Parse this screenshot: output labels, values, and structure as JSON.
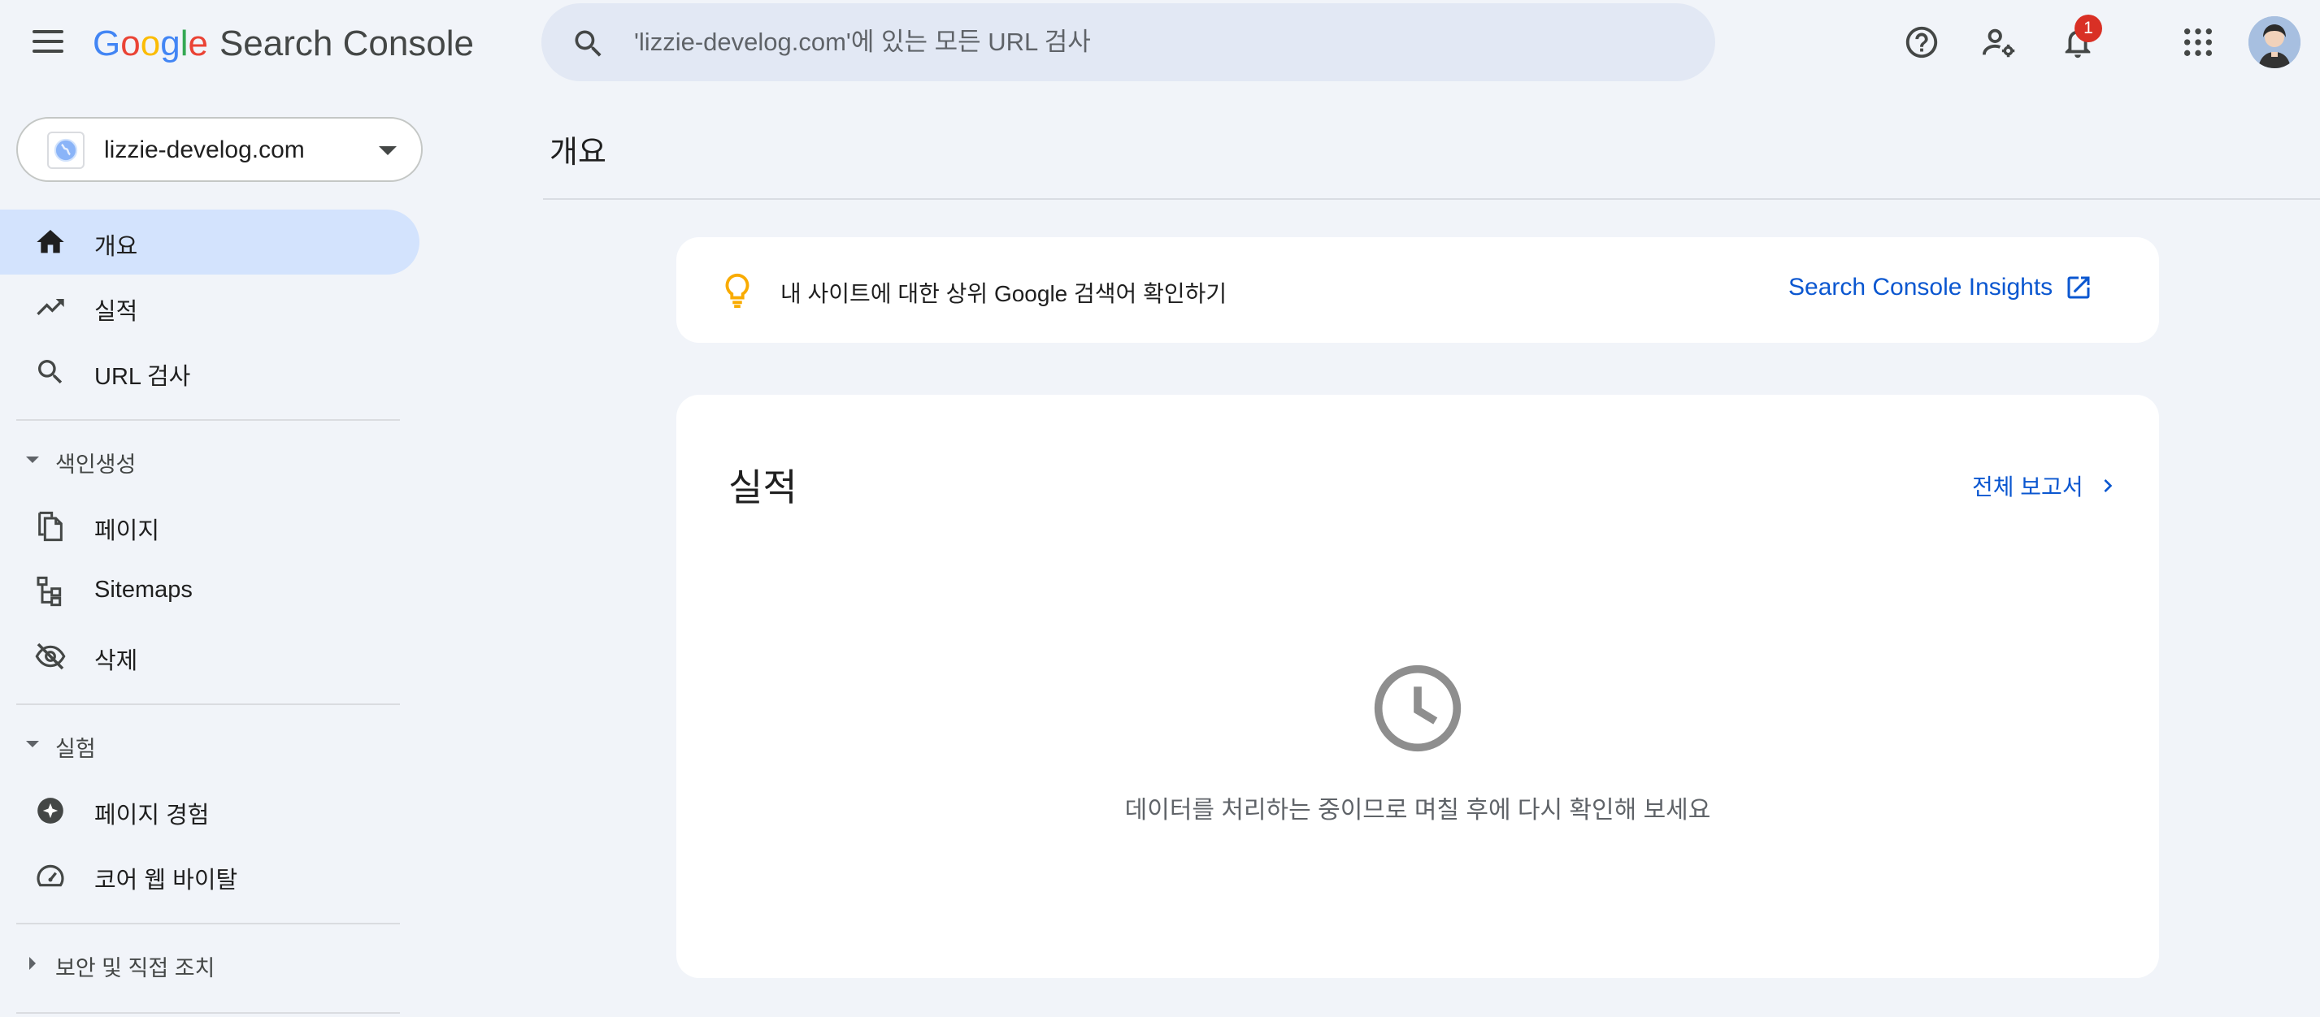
{
  "header": {
    "logo_letters": [
      "G",
      "o",
      "o",
      "g",
      "l",
      "e"
    ],
    "product_name": "Search Console",
    "search_placeholder": "'lizzie-develog.com'에 있는 모든 URL 검사",
    "notification_count": "1",
    "icons": [
      "menu-icon",
      "search-icon",
      "help-icon",
      "manage-users-icon",
      "bell-icon",
      "apps-grid-icon",
      "avatar"
    ]
  },
  "sidebar": {
    "property": "lizzie-develog.com",
    "items": [
      {
        "label": "개요",
        "icon": "home-icon",
        "active": true
      },
      {
        "label": "실적",
        "icon": "trending-up-icon"
      },
      {
        "label": "URL 검사",
        "icon": "search-icon"
      }
    ],
    "sections": [
      {
        "label": "색인생성",
        "expanded": true,
        "items": [
          {
            "label": "페이지",
            "icon": "pages-icon"
          },
          {
            "label": "Sitemaps",
            "icon": "sitemap-icon"
          },
          {
            "label": "삭제",
            "icon": "visibility-off-icon"
          }
        ]
      },
      {
        "label": "실험",
        "expanded": true,
        "items": [
          {
            "label": "페이지 경험",
            "icon": "experience-icon"
          },
          {
            "label": "코어 웹 바이탈",
            "icon": "speed-gauge-icon"
          }
        ]
      },
      {
        "label": "보안 및 직접 조치",
        "expanded": false
      }
    ]
  },
  "main": {
    "page_title": "개요",
    "insight": {
      "text": "내 사이트에 대한 상위 Google 검색어 확인하기",
      "link": "Search Console Insights"
    },
    "performance": {
      "title": "실적",
      "full_report": "전체 보고서",
      "message": "데이터를 처리하는 중이므로 며칠 후에 다시 확인해 보세요"
    }
  },
  "colors": {
    "background": "#f1f4f9",
    "active_nav": "#d3e3fd",
    "link": "#0b57d0",
    "badge": "#d93025"
  }
}
